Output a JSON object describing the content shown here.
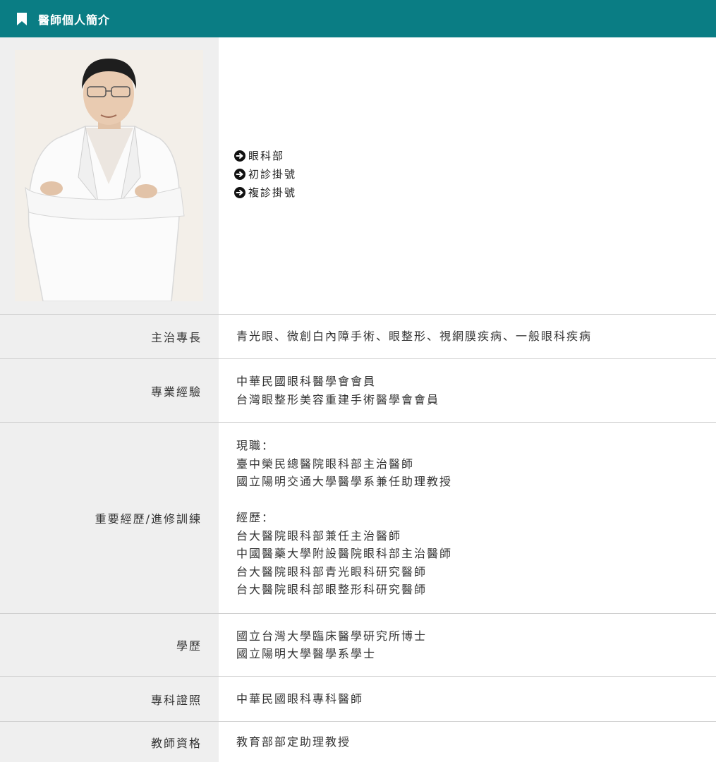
{
  "header": {
    "title": "醫師個人簡介",
    "icon": "bookmark-icon",
    "bg_color": "#0a7d84"
  },
  "links": [
    {
      "label": "眼科部",
      "icon": "arrow-right-circle-icon"
    },
    {
      "label": "初診掛號",
      "icon": "arrow-right-circle-icon"
    },
    {
      "label": "複診掛號",
      "icon": "arrow-right-circle-icon"
    }
  ],
  "rows": [
    {
      "label": "主治專長",
      "lines": [
        "青光眼、微創白內障手術、眼整形、視網膜疾病、一般眼科疾病"
      ]
    },
    {
      "label": "專業經驗",
      "lines": [
        "中華民國眼科醫學會會員",
        "台灣眼整形美容重建手術醫學會會員"
      ]
    },
    {
      "label": "重要經歷/進修訓練",
      "lines": [
        "現職：",
        "臺中榮民總醫院眼科部主治醫師",
        "國立陽明交通大學醫學系兼任助理教授",
        "",
        "經歷：",
        "台大醫院眼科部兼任主治醫師",
        "中國醫藥大學附設醫院眼科部主治醫師",
        "台大醫院眼科部青光眼科研究醫師",
        "台大醫院眼科部眼整形科研究醫師"
      ]
    },
    {
      "label": "學歷",
      "lines": [
        "國立台灣大學臨床醫學研究所博士",
        "國立陽明大學醫學系學士"
      ]
    },
    {
      "label": "專科證照",
      "lines": [
        "中華民國眼科專科醫師"
      ]
    },
    {
      "label": "教師資格",
      "lines": [
        "教育部部定助理教授"
      ]
    }
  ]
}
